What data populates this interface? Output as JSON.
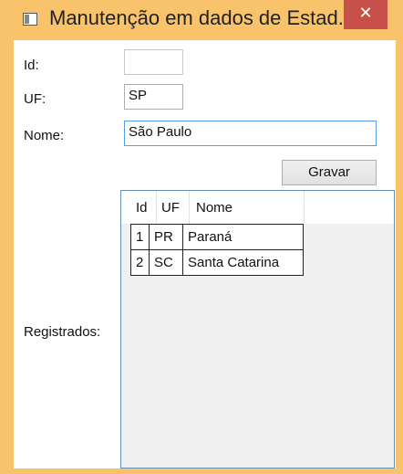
{
  "window": {
    "title": "Manutenção em dados de Estad...",
    "close_glyph": "✕",
    "icon": "window-app-icon"
  },
  "form": {
    "id": {
      "label": "Id:",
      "value": ""
    },
    "uf": {
      "label": "UF:",
      "value": "SP"
    },
    "nome": {
      "label": "Nome:",
      "value": "São Paulo"
    },
    "save_button": "Gravar",
    "registered_label": "Registrados:"
  },
  "grid": {
    "columns": [
      "Id",
      "UF",
      "Nome"
    ],
    "rows": [
      {
        "id": "1",
        "uf": "PR",
        "nome": "Paraná"
      },
      {
        "id": "2",
        "uf": "SC",
        "nome": "Santa Catarina"
      }
    ]
  },
  "colors": {
    "frame": "#f8c36a",
    "close": "#c8504a",
    "focus_border": "#569de5",
    "grid_border": "#688caf"
  }
}
